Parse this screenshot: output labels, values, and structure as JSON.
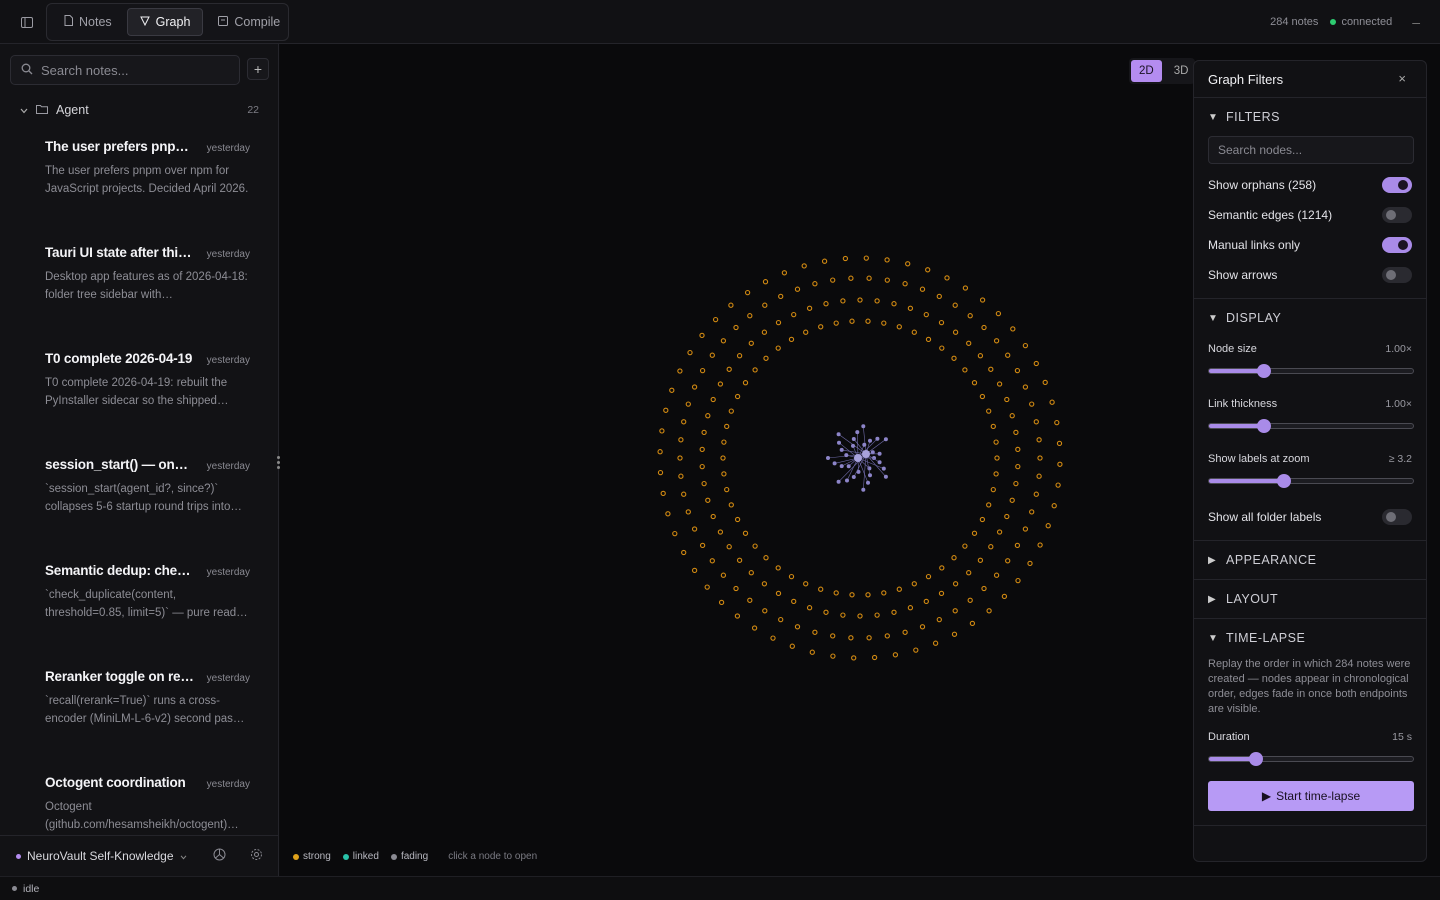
{
  "topbar": {
    "tabs": [
      {
        "label": "Notes",
        "active": false
      },
      {
        "label": "Graph",
        "active": true
      },
      {
        "label": "Compile",
        "active": false
      }
    ],
    "note_count": "284 notes",
    "connection": "connected"
  },
  "sidebar": {
    "search_placeholder": "Search notes...",
    "add_label": "+",
    "folder": {
      "name": "Agent",
      "count": "22"
    },
    "notes": [
      {
        "title": "The user prefers pnpm over npm",
        "date": "yesterday",
        "preview": "The user prefers pnpm over npm for JavaScript projects. Decided April 2026."
      },
      {
        "title": "Tauri UI state after this session",
        "date": "yesterday",
        "preview": "Desktop app features as of 2026-04-18: folder tree sidebar with…"
      },
      {
        "title": "T0 complete 2026-04-19",
        "date": "yesterday",
        "preview": "T0 complete 2026-04-19: rebuilt the PyInstaller sidecar so the shipped…"
      },
      {
        "title": "session_start() — one call",
        "date": "yesterday",
        "preview": "`session_start(agent_id?, since?)` collapses 5-6 startup round trips into…"
      },
      {
        "title": "Semantic dedup: check duplicates",
        "date": "yesterday",
        "preview": "`check_duplicate(content, threshold=0.85, limit=5)` — pure read…"
      },
      {
        "title": "Reranker toggle on recall",
        "date": "yesterday",
        "preview": "`recall(rerank=True)` runs a cross-encoder (MiniLM-L-6-v2) second pas…"
      },
      {
        "title": "Octogent coordination",
        "date": "yesterday",
        "preview": "Octogent (github.com/hesamsheikh/octogent)…"
      }
    ],
    "vault_name": "NeuroVault Self-Knowledge"
  },
  "graph": {
    "dim_options": [
      "2D",
      "3D"
    ],
    "active_dim": "2D",
    "legend": [
      {
        "label": "strong",
        "color": "#e0a21b"
      },
      {
        "label": "linked",
        "color": "#29c2a9"
      },
      {
        "label": "fading",
        "color": "#8a8a92"
      }
    ],
    "hint": "click a node to open",
    "orphan_color": "#d28a12",
    "cluster_color": "#8d85c9"
  },
  "filters": {
    "title": "Graph Filters",
    "close_label": "×",
    "sections": {
      "filters": "FILTERS",
      "display": "DISPLAY",
      "appearance": "APPEARANCE",
      "layout": "LAYOUT",
      "timelapse": "TIME-LAPSE"
    },
    "node_search_placeholder": "Search nodes...",
    "toggles": [
      {
        "label": "Show orphans (258)",
        "on": true
      },
      {
        "label": "Semantic edges (1214)",
        "on": false
      },
      {
        "label": "Manual links only",
        "on": true
      },
      {
        "label": "Show arrows",
        "on": false
      }
    ],
    "sliders": [
      {
        "label": "Node size",
        "value": "1.00×",
        "fraction": 0.27
      },
      {
        "label": "Link thickness",
        "value": "1.00×",
        "fraction": 0.27
      },
      {
        "label": "Show labels at zoom",
        "value": "≥ 3.2",
        "fraction": 0.37
      }
    ],
    "folder_labels": {
      "label": "Show all folder labels",
      "on": false
    },
    "timelapse_desc": "Replay the order in which 284 notes were created — nodes appear in chronological order, edges fade in once both endpoints are visible.",
    "duration": {
      "label": "Duration",
      "value": "15 s",
      "fraction": 0.23
    },
    "start_label": "Start time-lapse"
  },
  "status": {
    "text": "idle"
  },
  "colors": {
    "accent": "#b48cf0",
    "connected": "#2ecc71"
  }
}
